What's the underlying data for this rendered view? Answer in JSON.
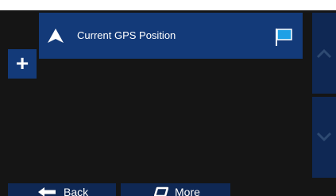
{
  "route": {
    "point_label": "Current GPS Position",
    "point_icon": "navigation-arrow-icon",
    "destination_icon": "flag-icon"
  },
  "actions": {
    "add_label": "+",
    "back_label": "Back",
    "more_label": "More"
  },
  "colors": {
    "background": "#151515",
    "button": "#133a79",
    "button_dark": "#0f2854",
    "flag": "#1ea0e6"
  }
}
